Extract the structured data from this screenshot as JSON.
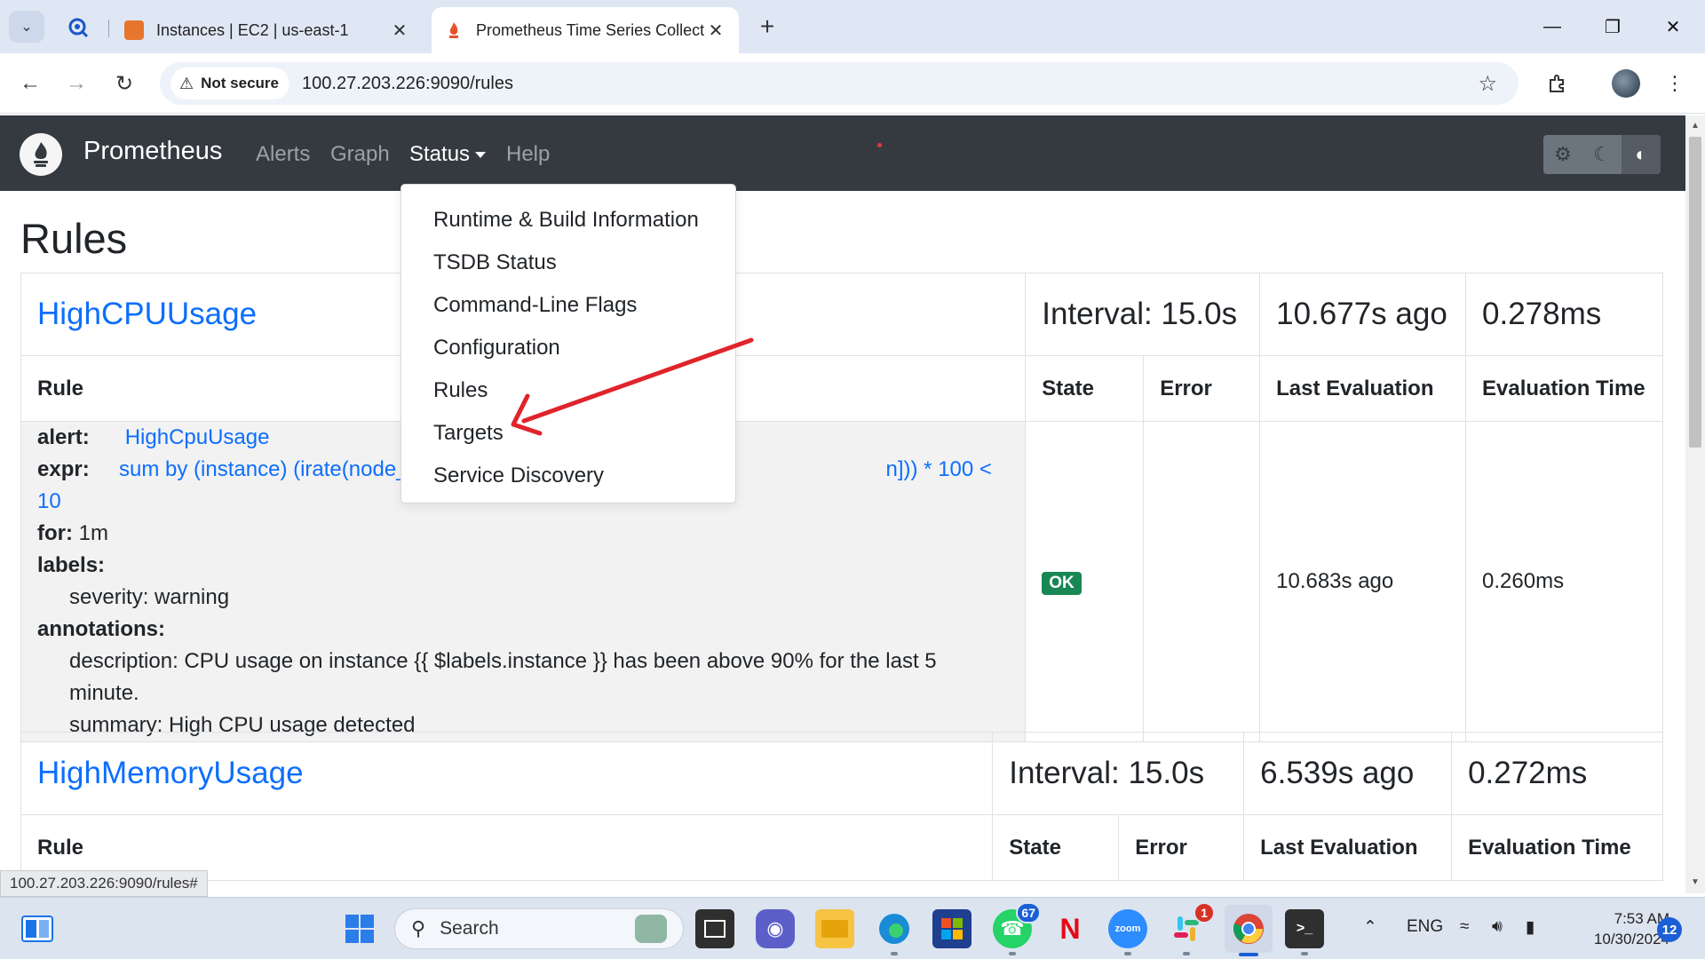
{
  "browser": {
    "tabs": [
      {
        "label": "Instances | EC2 | us-east-1",
        "color": "#e8752d"
      },
      {
        "label": "Prometheus Time Series Collect",
        "color": "#e6522c"
      }
    ],
    "url": "100.27.203.226:9090/rules",
    "security_label": "Not secure",
    "status_url": "100.27.203.226:9090/rules#"
  },
  "prometheus": {
    "brand": "Prometheus",
    "nav": {
      "alerts": "Alerts",
      "graph": "Graph",
      "status": "Status",
      "help": "Help"
    },
    "status_menu": [
      "Runtime & Build Information",
      "TSDB Status",
      "Command-Line Flags",
      "Configuration",
      "Rules",
      "Targets",
      "Service Discovery"
    ]
  },
  "page": {
    "title": "Rules",
    "column_headers": {
      "rule": "Rule",
      "state": "State",
      "error": "Error",
      "last_evaluation": "Last Evaluation",
      "evaluation_time": "Evaluation Time"
    },
    "groups": [
      {
        "name": "HighCPUUsage",
        "interval": "Interval: 15.0s",
        "last_eval": "10.677s ago",
        "eval_time": "0.278ms",
        "rule": {
          "alert_label": "alert:",
          "alert_value": "HighCpuUsage",
          "expr_label": "expr:",
          "expr_value_start": "sum by (instance) (irate(node_",
          "expr_value_end": "n])) * 100 < 10",
          "for_label": "for:",
          "for_value": "1m",
          "labels_label": "labels:",
          "severity": "severity: warning",
          "annotations_label": "annotations:",
          "description": "description: CPU usage on instance {{ $labels.instance }} has been above 90% for the last 5 minute.",
          "summary": "summary: High CPU usage detected",
          "state": "OK",
          "error": "",
          "last_evaluation": "10.683s ago",
          "evaluation_time": "0.260ms"
        }
      },
      {
        "name": "HighMemoryUsage",
        "interval": "Interval: 15.0s",
        "last_eval": "6.539s ago",
        "eval_time": "0.272ms"
      }
    ]
  },
  "taskbar": {
    "search_placeholder": "Search",
    "whatsapp_badge": "67",
    "slack_badge": "1",
    "language": "ENG",
    "time": "7:53 AM",
    "date": "10/30/2024",
    "notifications": "12"
  }
}
